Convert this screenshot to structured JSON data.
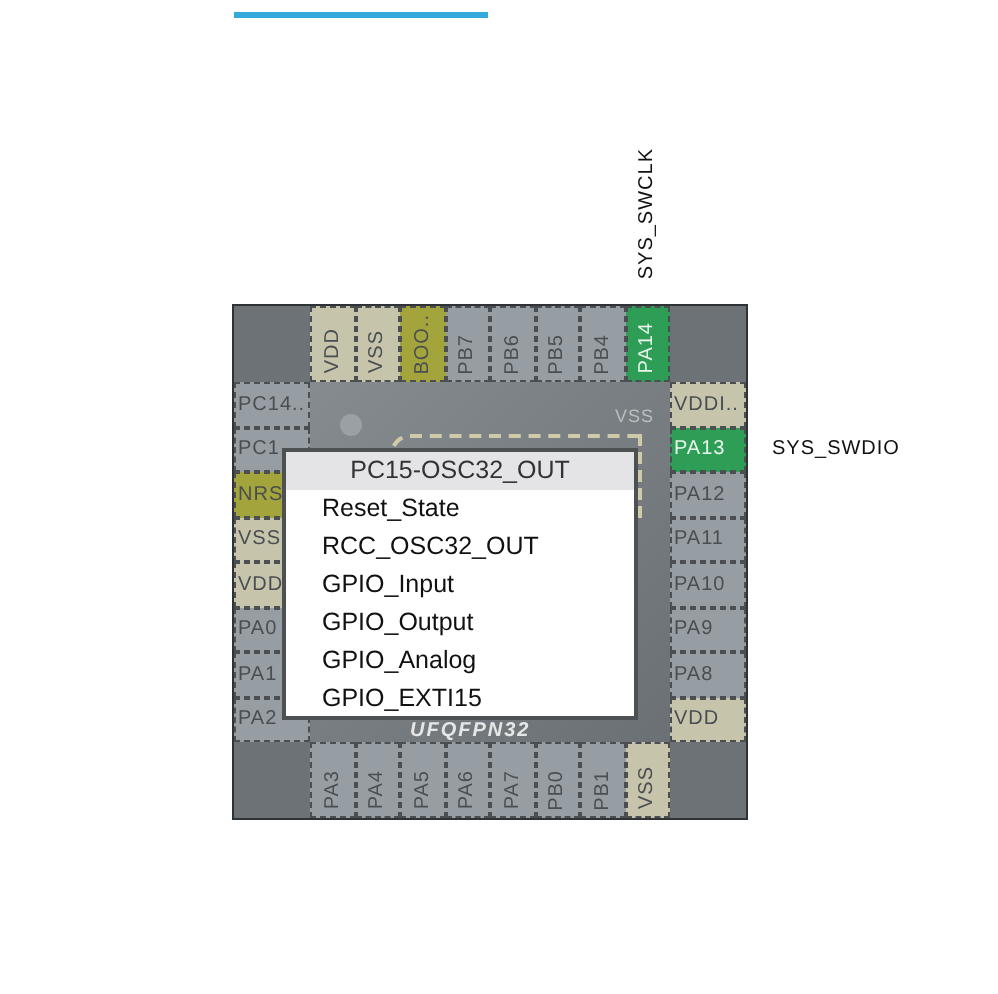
{
  "pins": {
    "top": [
      {
        "name": "VDD",
        "kind": "power"
      },
      {
        "name": "VSS",
        "kind": "power"
      },
      {
        "name": "BOO..",
        "kind": "boot"
      },
      {
        "name": "PB7",
        "kind": "io"
      },
      {
        "name": "PB6",
        "kind": "io"
      },
      {
        "name": "PB5",
        "kind": "io"
      },
      {
        "name": "PB4",
        "kind": "io"
      },
      {
        "name": "PA14",
        "kind": "assigned",
        "signal": "SYS_SWCLK"
      }
    ],
    "left": [
      {
        "name": "PC14..",
        "kind": "io"
      },
      {
        "name": "PC1",
        "kind": "io"
      },
      {
        "name": "NRS",
        "kind": "boot"
      },
      {
        "name": "VSS",
        "kind": "power"
      },
      {
        "name": "VDD",
        "kind": "power"
      },
      {
        "name": "PA0",
        "kind": "io"
      },
      {
        "name": "PA1",
        "kind": "io"
      },
      {
        "name": "PA2",
        "kind": "io"
      }
    ],
    "right": [
      {
        "name": "VDDI..",
        "kind": "power"
      },
      {
        "name": "PA13",
        "kind": "assigned",
        "signal": "SYS_SWDIO"
      },
      {
        "name": "PA12",
        "kind": "io"
      },
      {
        "name": "PA11",
        "kind": "io"
      },
      {
        "name": "PA10",
        "kind": "io"
      },
      {
        "name": "PA9",
        "kind": "io"
      },
      {
        "name": "PA8",
        "kind": "io"
      },
      {
        "name": "VDD",
        "kind": "power"
      }
    ],
    "bottom": [
      {
        "name": "PA3",
        "kind": "io"
      },
      {
        "name": "PA4",
        "kind": "io"
      },
      {
        "name": "PA5",
        "kind": "io"
      },
      {
        "name": "PA6",
        "kind": "io"
      },
      {
        "name": "PA7",
        "kind": "io"
      },
      {
        "name": "PB0",
        "kind": "io"
      },
      {
        "name": "PB1",
        "kind": "io"
      },
      {
        "name": "VSS",
        "kind": "power"
      }
    ]
  },
  "chip": {
    "corner_label": "VSS",
    "package": "UFQFPN32"
  },
  "popup": {
    "title": "PC15-OSC32_OUT",
    "options": [
      "Reset_State",
      "RCC_OSC32_OUT",
      "GPIO_Input",
      "GPIO_Output",
      "GPIO_Analog",
      "GPIO_EXTI15"
    ]
  }
}
